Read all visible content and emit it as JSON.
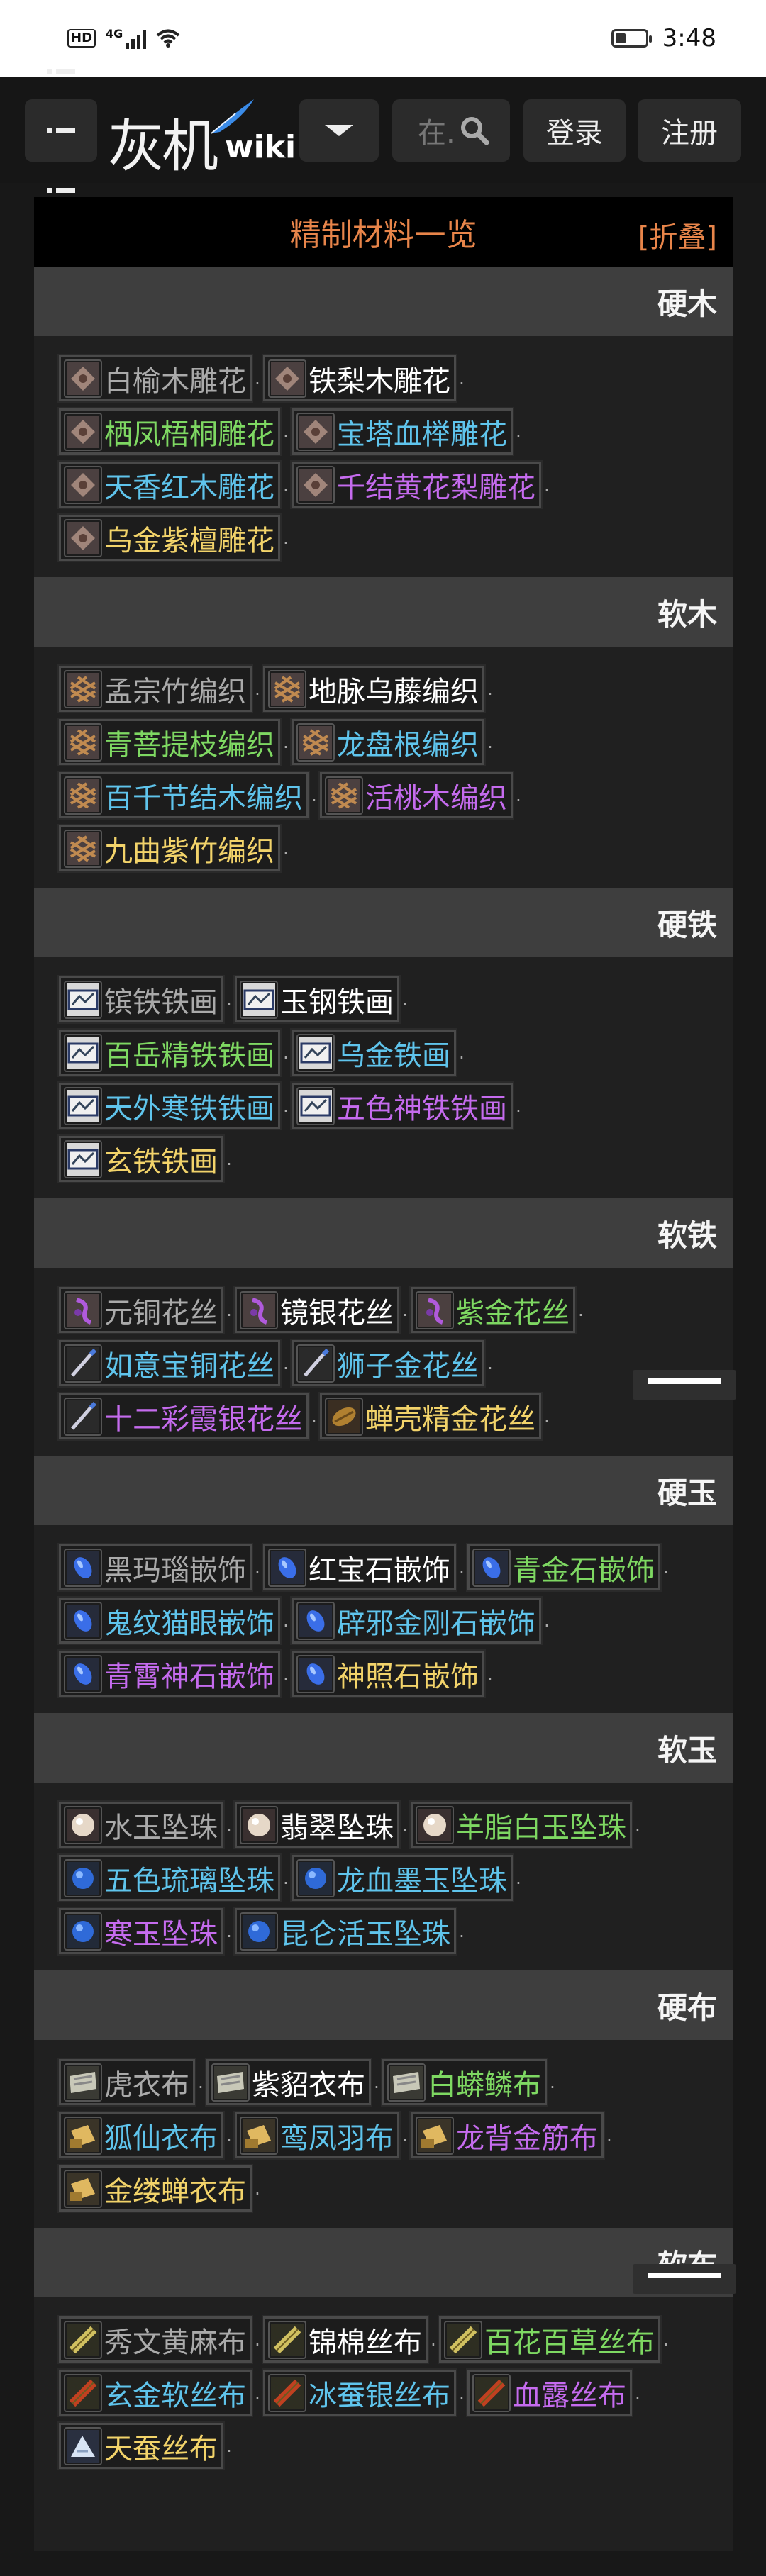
{
  "status_bar": {
    "network": "4G",
    "hd": "HD",
    "time": "3:48"
  },
  "header": {
    "logo_text": "灰机",
    "logo_wiki": "wiki",
    "search_placeholder": "在.",
    "login_label": "登录",
    "register_label": "注册"
  },
  "panel": {
    "title": "精制材料一览",
    "fold_label": "[折叠]"
  },
  "colors": {
    "accent": "#e8854a",
    "gray": "#aaaaaa",
    "white": "#ffffff",
    "green": "#7ed862",
    "blue": "#5fc4ec",
    "purple": "#c56bee",
    "gold": "#f2d36a"
  },
  "sections": [
    {
      "title": "硬木",
      "rows": [
        [
          {
            "name": "白榆木雕花",
            "quality": "gray",
            "icon": "wood-carving-icon"
          },
          {
            "name": "铁梨木雕花",
            "quality": "white",
            "icon": "wood-carving-icon"
          }
        ],
        [
          {
            "name": "栖凤梧桐雕花",
            "quality": "green",
            "icon": "wood-carving-icon"
          },
          {
            "name": "宝塔血榉雕花",
            "quality": "blue",
            "icon": "wood-carving-icon"
          }
        ],
        [
          {
            "name": "天香红木雕花",
            "quality": "blue",
            "icon": "wood-carving-icon"
          },
          {
            "name": "千结黄花梨雕花",
            "quality": "purple",
            "icon": "wood-carving-icon"
          }
        ],
        [
          {
            "name": "乌金紫檀雕花",
            "quality": "gold",
            "icon": "wood-carving-icon"
          }
        ]
      ]
    },
    {
      "title": "软木",
      "rows": [
        [
          {
            "name": "孟宗竹编织",
            "quality": "gray",
            "icon": "weaving-icon"
          },
          {
            "name": "地脉乌藤编织",
            "quality": "white",
            "icon": "weaving-icon"
          }
        ],
        [
          {
            "name": "青菩提枝编织",
            "quality": "green",
            "icon": "weaving-icon"
          },
          {
            "name": "龙盘根编织",
            "quality": "blue",
            "icon": "weaving-icon"
          }
        ],
        [
          {
            "name": "百千节结木编织",
            "quality": "blue",
            "icon": "weaving-icon"
          },
          {
            "name": "活桃木编织",
            "quality": "purple",
            "icon": "weaving-icon"
          }
        ],
        [
          {
            "name": "九曲紫竹编织",
            "quality": "gold",
            "icon": "weaving-icon"
          }
        ]
      ]
    },
    {
      "title": "硬铁",
      "rows": [
        [
          {
            "name": "镔铁铁画",
            "quality": "gray",
            "icon": "iron-painting-icon"
          },
          {
            "name": "玉钢铁画",
            "quality": "white",
            "icon": "iron-painting-icon"
          }
        ],
        [
          {
            "name": "百岳精铁铁画",
            "quality": "green",
            "icon": "iron-painting-icon"
          },
          {
            "name": "乌金铁画",
            "quality": "blue",
            "icon": "iron-painting-icon"
          }
        ],
        [
          {
            "name": "天外寒铁铁画",
            "quality": "blue",
            "icon": "iron-painting-icon"
          },
          {
            "name": "五色神铁铁画",
            "quality": "purple",
            "icon": "iron-painting-icon"
          }
        ],
        [
          {
            "name": "玄铁铁画",
            "quality": "gold",
            "icon": "iron-painting-icon"
          }
        ]
      ]
    },
    {
      "title": "软铁",
      "rows": [
        [
          {
            "name": "元铜花丝",
            "quality": "gray",
            "icon": "filigree-icon"
          },
          {
            "name": "镜银花丝",
            "quality": "white",
            "icon": "filigree-icon"
          },
          {
            "name": "紫金花丝",
            "quality": "green",
            "icon": "filigree-icon"
          }
        ],
        [
          {
            "name": "如意宝铜花丝",
            "quality": "blue",
            "icon": "filigree-pen-icon"
          },
          {
            "name": "狮子金花丝",
            "quality": "blue",
            "icon": "filigree-pen-icon"
          }
        ],
        [
          {
            "name": "十二彩霞银花丝",
            "quality": "purple",
            "icon": "filigree-pen-icon"
          },
          {
            "name": "蝉壳精金花丝",
            "quality": "gold",
            "icon": "cicada-shell-icon"
          }
        ]
      ]
    },
    {
      "title": "硬玉",
      "rows": [
        [
          {
            "name": "黑玛瑙嵌饰",
            "quality": "gray",
            "icon": "gem-inlay-icon"
          },
          {
            "name": "红宝石嵌饰",
            "quality": "white",
            "icon": "gem-inlay-icon"
          },
          {
            "name": "青金石嵌饰",
            "quality": "green",
            "icon": "gem-inlay-icon"
          }
        ],
        [
          {
            "name": "鬼纹猫眼嵌饰",
            "quality": "blue",
            "icon": "gem-inlay-icon"
          },
          {
            "name": "辟邪金刚石嵌饰",
            "quality": "blue",
            "icon": "gem-inlay-icon"
          }
        ],
        [
          {
            "name": "青霄神石嵌饰",
            "quality": "purple",
            "icon": "gem-inlay-icon"
          },
          {
            "name": "神照石嵌饰",
            "quality": "gold",
            "icon": "gem-inlay-icon"
          }
        ]
      ]
    },
    {
      "title": "软玉",
      "rows": [
        [
          {
            "name": "水玉坠珠",
            "quality": "gray",
            "icon": "pearl-icon"
          },
          {
            "name": "翡翠坠珠",
            "quality": "white",
            "icon": "pearl-icon"
          },
          {
            "name": "羊脂白玉坠珠",
            "quality": "green",
            "icon": "pearl-icon"
          }
        ],
        [
          {
            "name": "五色琉璃坠珠",
            "quality": "blue",
            "icon": "blue-bead-icon"
          },
          {
            "name": "龙血墨玉坠珠",
            "quality": "blue",
            "icon": "blue-bead-icon"
          }
        ],
        [
          {
            "name": "寒玉坠珠",
            "quality": "purple",
            "icon": "blue-bead-icon"
          },
          {
            "name": "昆仑活玉坠珠",
            "quality": "blue",
            "icon": "blue-bead-icon"
          }
        ]
      ]
    },
    {
      "title": "硬布",
      "rows": [
        [
          {
            "name": "虎衣布",
            "quality": "gray",
            "icon": "cloth-icon"
          },
          {
            "name": "紫貂衣布",
            "quality": "white",
            "icon": "cloth-icon"
          },
          {
            "name": "白蟒鳞布",
            "quality": "green",
            "icon": "cloth-icon"
          }
        ],
        [
          {
            "name": "狐仙衣布",
            "quality": "blue",
            "icon": "cloth-roll-icon"
          },
          {
            "name": "鸾凤羽布",
            "quality": "blue",
            "icon": "cloth-roll-icon"
          },
          {
            "name": "龙背金筋布",
            "quality": "purple",
            "icon": "cloth-roll-icon"
          }
        ],
        [
          {
            "name": "金缕蝉衣布",
            "quality": "gold",
            "icon": "cloth-roll-icon"
          }
        ]
      ]
    },
    {
      "title": "软布",
      "rows": [
        [
          {
            "name": "秀文黄麻布",
            "quality": "gray",
            "icon": "silk-roll-icon"
          },
          {
            "name": "锦棉丝布",
            "quality": "white",
            "icon": "silk-roll-icon"
          },
          {
            "name": "百花百草丝布",
            "quality": "green",
            "icon": "silk-roll-icon"
          }
        ],
        [
          {
            "name": "玄金软丝布",
            "quality": "blue",
            "icon": "silk-roll-icon"
          },
          {
            "name": "冰蚕银丝布",
            "quality": "blue",
            "icon": "silk-roll-icon"
          },
          {
            "name": "血露丝布",
            "quality": "purple",
            "icon": "silk-roll-icon"
          }
        ],
        [
          {
            "name": "天蚕丝布",
            "quality": "gold",
            "icon": "silk-fold-icon"
          }
        ]
      ]
    }
  ]
}
